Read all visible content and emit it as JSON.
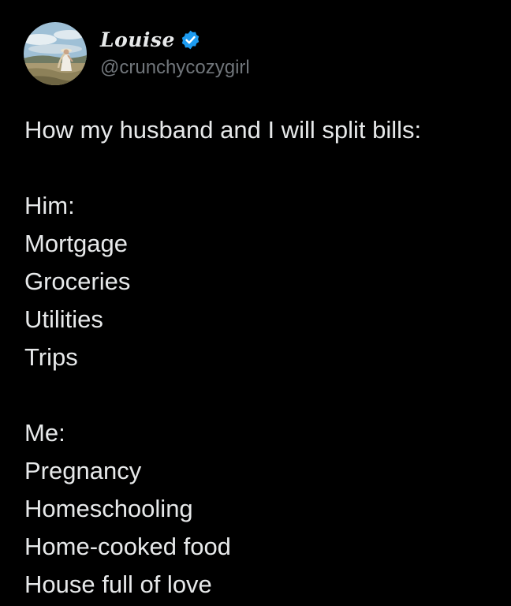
{
  "author": {
    "display_name": "Louise",
    "handle": "@crunchycozygirl",
    "verified": true,
    "verified_color": "#1d9bf0"
  },
  "tweet": {
    "intro": "How my husband and I will split bills:",
    "him_heading": "Him:",
    "him_items": [
      "Mortgage",
      "Groceries",
      "Utilities",
      "Trips"
    ],
    "me_heading": "Me:",
    "me_items": [
      "Pregnancy",
      "Homeschooling",
      "Home-cooked food",
      "House full of love"
    ]
  },
  "theme": {
    "background": "#000000",
    "text": "#e7e9ea",
    "secondary_text": "#71767b"
  }
}
